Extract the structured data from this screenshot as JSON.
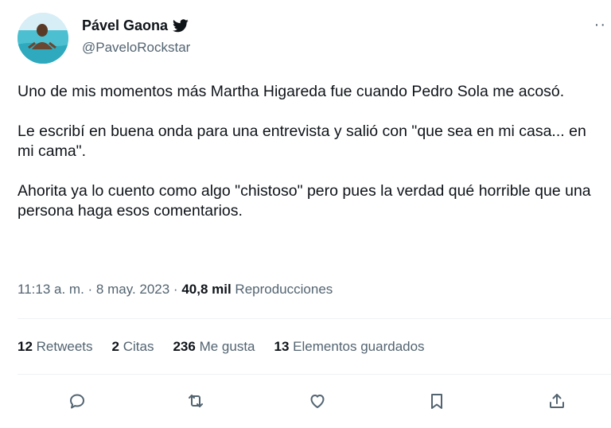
{
  "author": {
    "display_name": "Pável Gaona",
    "handle": "@PaveloRockstar",
    "verified_icon": "twitter-bird-icon",
    "avatar": "profile-photo-avatar"
  },
  "menu": {
    "more_label": "··"
  },
  "tweet": {
    "paragraphs": [
      "Uno de mis momentos más Martha Higareda fue cuando Pedro Sola me acosó.",
      "Le escribí en buena onda para una entrevista y salió con \"que sea en mi casa... en mi cama\".",
      "Ahorita ya lo cuento como algo \"chistoso\" pero pues la verdad qué horrible que una persona haga esos comentarios."
    ]
  },
  "meta": {
    "time": "11:13 a. m.",
    "sep1": " · ",
    "date": "8 may. 2023",
    "sep2": " · ",
    "views_count": "40,8 mil",
    "views_label": "Reproducciones"
  },
  "stats": {
    "retweets_count": "12",
    "retweets_label": "Retweets",
    "quotes_count": "2",
    "quotes_label": "Citas",
    "likes_count": "236",
    "likes_label": "Me gusta",
    "bookmarks_count": "13",
    "bookmarks_label": "Elementos guardados"
  },
  "actions": [
    "reply-icon",
    "retweet-icon",
    "like-icon",
    "bookmark-icon",
    "share-icon"
  ],
  "colors": {
    "text": "#0f1419",
    "secondary": "#536471",
    "divider": "#eff3f4"
  }
}
